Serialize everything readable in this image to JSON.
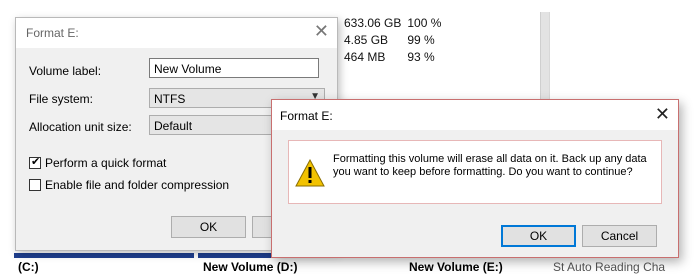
{
  "background": {
    "rows": [
      {
        "capacity": "633.06 GB",
        "percent": "100 %"
      },
      {
        "capacity": "4.85 GB",
        "percent": "99 %"
      },
      {
        "capacity": "464 MB",
        "percent": "93 %"
      }
    ],
    "volumes": [
      {
        "label": "(C:)"
      },
      {
        "label": "New Volume  (D:)"
      },
      {
        "label": "New Volume  (E:)"
      },
      {
        "label": "St  Auto  Reading  Cha"
      }
    ]
  },
  "format_dialog": {
    "title": "Format E:",
    "volume_label": {
      "label": "Volume label:",
      "value": "New Volume"
    },
    "file_system": {
      "label": "File system:",
      "value": "NTFS"
    },
    "allocation_unit": {
      "label": "Allocation unit size:",
      "value": "Default"
    },
    "quick_format": {
      "label": "Perform a quick format",
      "checked": true
    },
    "compression": {
      "label": "Enable file and folder compression",
      "checked": false
    },
    "ok_label": "OK"
  },
  "confirm_dialog": {
    "title": "Format E:",
    "message": "Formatting this volume will erase all data on it. Back up any data you want to keep before formatting. Do you want to continue?",
    "ok_label": "OK",
    "cancel_label": "Cancel"
  },
  "colors": {
    "accent": "#0078d7",
    "warning": "#f2c200",
    "volume_bar_blue": "#1f3f8f",
    "volume_bar_green": "#3a8a2a"
  },
  "icons": {
    "close": "close-icon",
    "warning": "warning-icon",
    "checkbox": "checkmark-icon",
    "dropdown": "chevron-down-icon"
  }
}
